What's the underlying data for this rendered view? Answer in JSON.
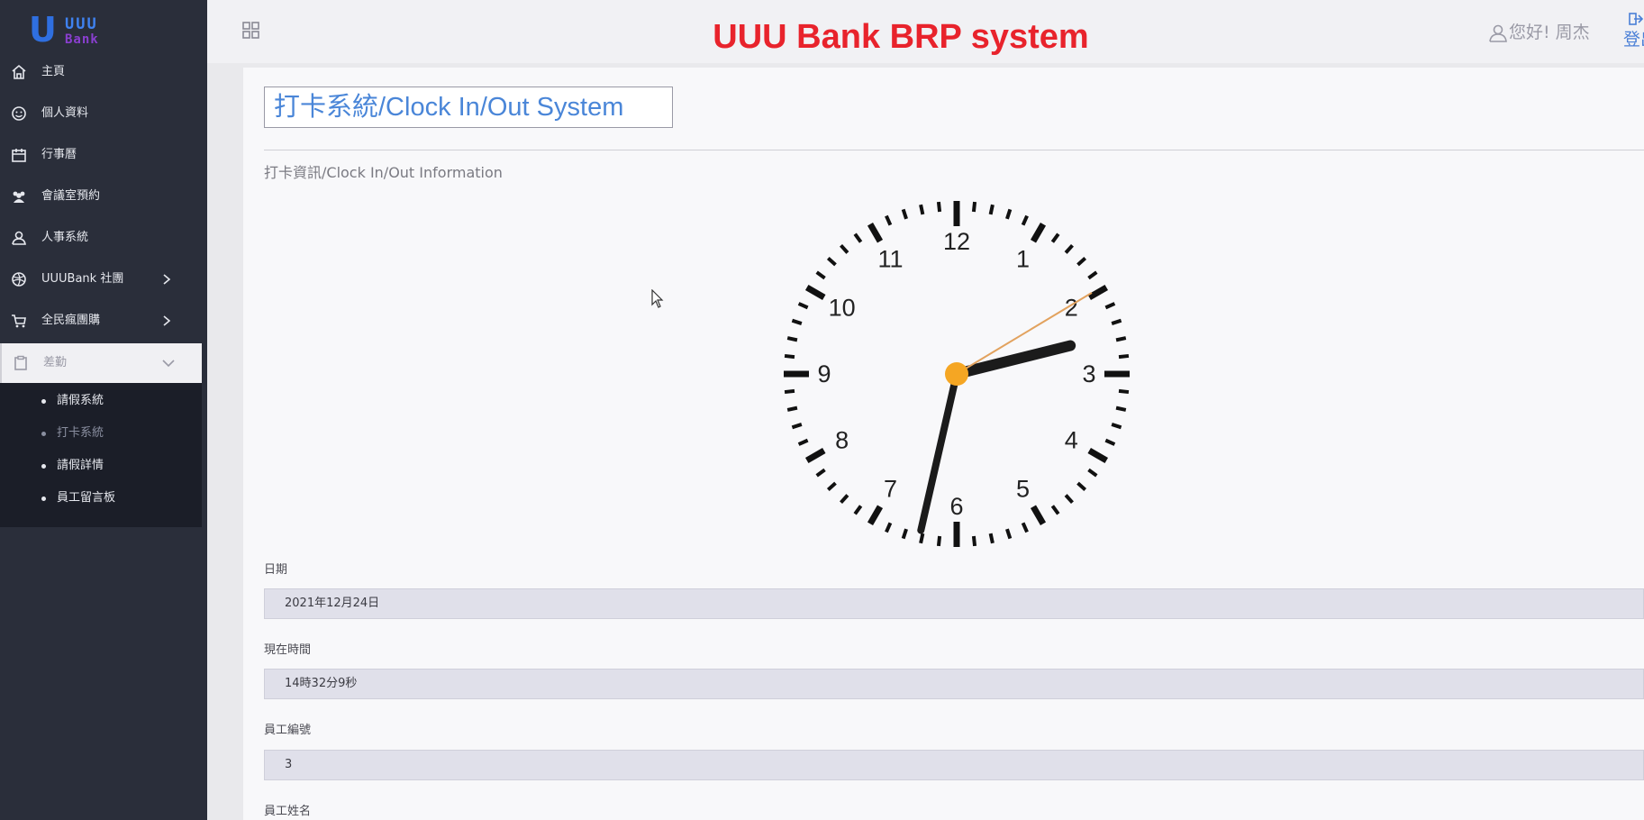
{
  "logo": {
    "mark": "U",
    "text_line1": "UUU",
    "text_line2": "Bank"
  },
  "header": {
    "title": "UUU Bank BRP system",
    "greeting": "您好! 周杰",
    "logout_label": "登出"
  },
  "sidebar": {
    "items": [
      {
        "label": "主頁",
        "icon": "home-icon"
      },
      {
        "label": "個人資料",
        "icon": "smiley-icon"
      },
      {
        "label": "行事曆",
        "icon": "calendar-icon"
      },
      {
        "label": "會議室預約",
        "icon": "users-icon"
      },
      {
        "label": "人事系統",
        "icon": "user-icon"
      },
      {
        "label": "UUUBank 社團",
        "icon": "globe-icon"
      },
      {
        "label": "全民瘋團購",
        "icon": "cart-icon"
      },
      {
        "label": "差勤",
        "icon": "clipboard-icon"
      }
    ],
    "submenu": [
      {
        "label": "請假系統"
      },
      {
        "label": "打卡系統"
      },
      {
        "label": "請假詳情"
      },
      {
        "label": "員工留言板"
      }
    ]
  },
  "page": {
    "title": "打卡系統/Clock In/Out System",
    "section_title": "打卡資訊/Clock In/Out Information"
  },
  "clock": {
    "hour": 14,
    "minute": 32,
    "second": 9,
    "numbers": [
      "12",
      "1",
      "2",
      "3",
      "4",
      "5",
      "6",
      "7",
      "8",
      "9",
      "10",
      "11"
    ]
  },
  "form": {
    "date_label": "日期",
    "date_value": "2021年12月24日",
    "time_label": "現在時間",
    "time_value": "14時32分9秒",
    "emp_id_label": "員工編號",
    "emp_id_value": "3",
    "emp_name_label": "員工姓名"
  },
  "colors": {
    "sidebar_bg": "#2a2e3a",
    "title_red": "#e8232c",
    "accent_blue": "#4a86d8",
    "clock_center": "#f5a623"
  }
}
